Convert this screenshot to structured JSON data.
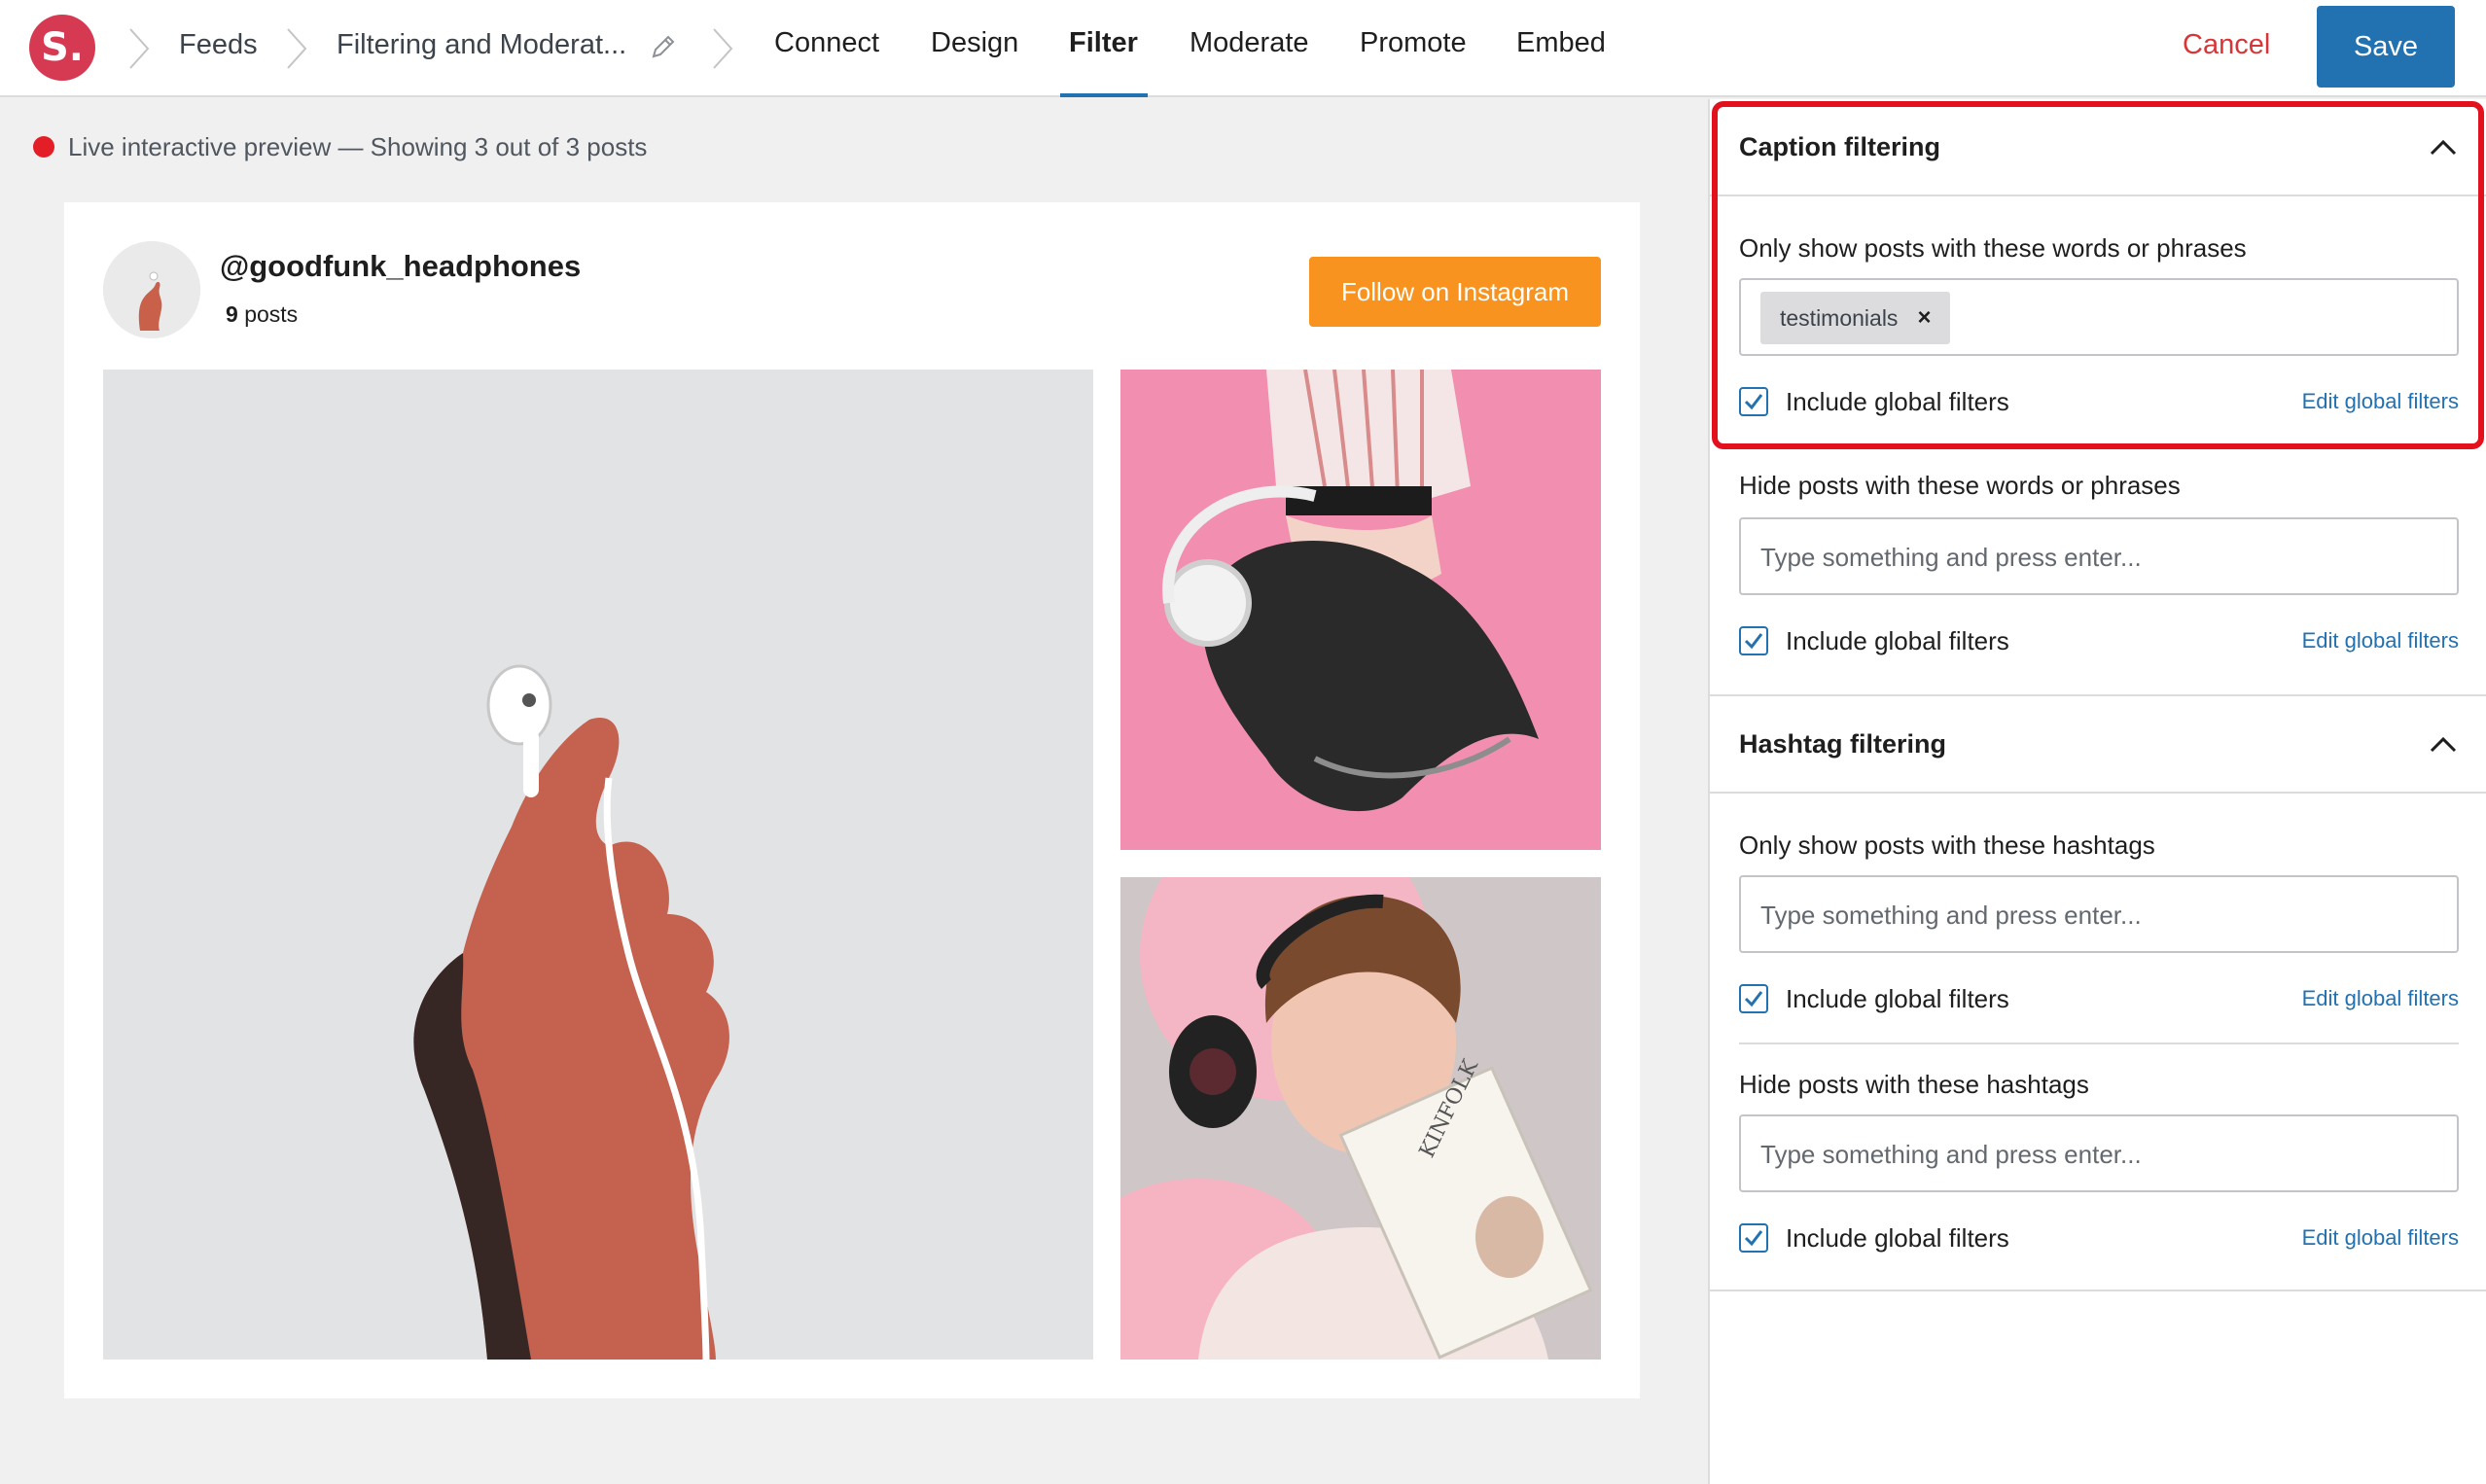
{
  "app": {
    "logo_text": "S."
  },
  "breadcrumb": {
    "feeds": "Feeds",
    "feed_name": "Filtering and Moderat..."
  },
  "nav": {
    "tabs": [
      "Connect",
      "Design",
      "Filter",
      "Moderate",
      "Promote",
      "Embed"
    ],
    "active": "Filter"
  },
  "actions": {
    "cancel": "Cancel",
    "save": "Save"
  },
  "preview": {
    "status": "Live interactive preview — Showing 3 out of 3 posts",
    "username": "@goodfunk_headphones",
    "post_count": "9",
    "post_count_label": "posts",
    "follow_button": "Follow on Instagram"
  },
  "caption_filtering": {
    "title": "Caption filtering",
    "only_show_label": "Only show posts with these words or phrases",
    "only_show_tags": [
      "testimonials"
    ],
    "only_show_include_global": "Include global filters",
    "only_show_edit_link": "Edit global filters",
    "hide_label": "Hide posts with these words or phrases",
    "hide_placeholder": "Type something and press enter...",
    "hide_include_global": "Include global filters",
    "hide_edit_link": "Edit global filters"
  },
  "hashtag_filtering": {
    "title": "Hashtag filtering",
    "only_show_label": "Only show posts with these hashtags",
    "only_show_placeholder": "Type something and press enter...",
    "only_show_include_global": "Include global filters",
    "only_show_edit_link": "Edit global filters",
    "hide_label": "Hide posts with these hashtags",
    "hide_placeholder": "Type something and press enter...",
    "hide_include_global": "Include global filters",
    "hide_edit_link": "Edit global filters"
  },
  "colors": {
    "accent": "#2271b1",
    "brand": "#d63a52",
    "follow_button": "#f7931e",
    "cancel": "#d63638",
    "highlight": "#e3101e"
  }
}
